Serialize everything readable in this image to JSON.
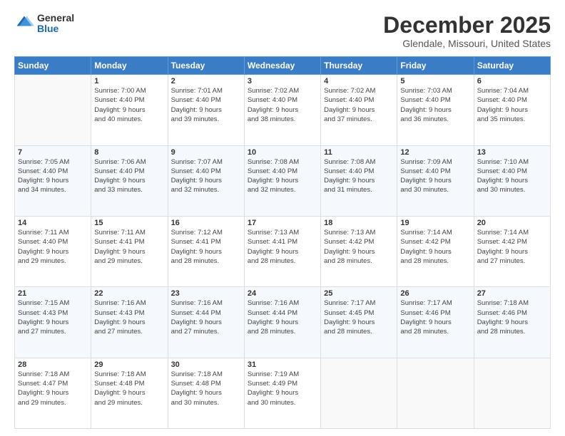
{
  "logo": {
    "general": "General",
    "blue": "Blue"
  },
  "title": "December 2025",
  "subtitle": "Glendale, Missouri, United States",
  "days_header": [
    "Sunday",
    "Monday",
    "Tuesday",
    "Wednesday",
    "Thursday",
    "Friday",
    "Saturday"
  ],
  "weeks": [
    [
      {
        "day": "",
        "info": ""
      },
      {
        "day": "1",
        "info": "Sunrise: 7:00 AM\nSunset: 4:40 PM\nDaylight: 9 hours\nand 40 minutes."
      },
      {
        "day": "2",
        "info": "Sunrise: 7:01 AM\nSunset: 4:40 PM\nDaylight: 9 hours\nand 39 minutes."
      },
      {
        "day": "3",
        "info": "Sunrise: 7:02 AM\nSunset: 4:40 PM\nDaylight: 9 hours\nand 38 minutes."
      },
      {
        "day": "4",
        "info": "Sunrise: 7:02 AM\nSunset: 4:40 PM\nDaylight: 9 hours\nand 37 minutes."
      },
      {
        "day": "5",
        "info": "Sunrise: 7:03 AM\nSunset: 4:40 PM\nDaylight: 9 hours\nand 36 minutes."
      },
      {
        "day": "6",
        "info": "Sunrise: 7:04 AM\nSunset: 4:40 PM\nDaylight: 9 hours\nand 35 minutes."
      }
    ],
    [
      {
        "day": "7",
        "info": "Sunrise: 7:05 AM\nSunset: 4:40 PM\nDaylight: 9 hours\nand 34 minutes."
      },
      {
        "day": "8",
        "info": "Sunrise: 7:06 AM\nSunset: 4:40 PM\nDaylight: 9 hours\nand 33 minutes."
      },
      {
        "day": "9",
        "info": "Sunrise: 7:07 AM\nSunset: 4:40 PM\nDaylight: 9 hours\nand 32 minutes."
      },
      {
        "day": "10",
        "info": "Sunrise: 7:08 AM\nSunset: 4:40 PM\nDaylight: 9 hours\nand 32 minutes."
      },
      {
        "day": "11",
        "info": "Sunrise: 7:08 AM\nSunset: 4:40 PM\nDaylight: 9 hours\nand 31 minutes."
      },
      {
        "day": "12",
        "info": "Sunrise: 7:09 AM\nSunset: 4:40 PM\nDaylight: 9 hours\nand 30 minutes."
      },
      {
        "day": "13",
        "info": "Sunrise: 7:10 AM\nSunset: 4:40 PM\nDaylight: 9 hours\nand 30 minutes."
      }
    ],
    [
      {
        "day": "14",
        "info": "Sunrise: 7:11 AM\nSunset: 4:40 PM\nDaylight: 9 hours\nand 29 minutes."
      },
      {
        "day": "15",
        "info": "Sunrise: 7:11 AM\nSunset: 4:41 PM\nDaylight: 9 hours\nand 29 minutes."
      },
      {
        "day": "16",
        "info": "Sunrise: 7:12 AM\nSunset: 4:41 PM\nDaylight: 9 hours\nand 28 minutes."
      },
      {
        "day": "17",
        "info": "Sunrise: 7:13 AM\nSunset: 4:41 PM\nDaylight: 9 hours\nand 28 minutes."
      },
      {
        "day": "18",
        "info": "Sunrise: 7:13 AM\nSunset: 4:42 PM\nDaylight: 9 hours\nand 28 minutes."
      },
      {
        "day": "19",
        "info": "Sunrise: 7:14 AM\nSunset: 4:42 PM\nDaylight: 9 hours\nand 28 minutes."
      },
      {
        "day": "20",
        "info": "Sunrise: 7:14 AM\nSunset: 4:42 PM\nDaylight: 9 hours\nand 27 minutes."
      }
    ],
    [
      {
        "day": "21",
        "info": "Sunrise: 7:15 AM\nSunset: 4:43 PM\nDaylight: 9 hours\nand 27 minutes."
      },
      {
        "day": "22",
        "info": "Sunrise: 7:16 AM\nSunset: 4:43 PM\nDaylight: 9 hours\nand 27 minutes."
      },
      {
        "day": "23",
        "info": "Sunrise: 7:16 AM\nSunset: 4:44 PM\nDaylight: 9 hours\nand 27 minutes."
      },
      {
        "day": "24",
        "info": "Sunrise: 7:16 AM\nSunset: 4:44 PM\nDaylight: 9 hours\nand 28 minutes."
      },
      {
        "day": "25",
        "info": "Sunrise: 7:17 AM\nSunset: 4:45 PM\nDaylight: 9 hours\nand 28 minutes."
      },
      {
        "day": "26",
        "info": "Sunrise: 7:17 AM\nSunset: 4:46 PM\nDaylight: 9 hours\nand 28 minutes."
      },
      {
        "day": "27",
        "info": "Sunrise: 7:18 AM\nSunset: 4:46 PM\nDaylight: 9 hours\nand 28 minutes."
      }
    ],
    [
      {
        "day": "28",
        "info": "Sunrise: 7:18 AM\nSunset: 4:47 PM\nDaylight: 9 hours\nand 29 minutes."
      },
      {
        "day": "29",
        "info": "Sunrise: 7:18 AM\nSunset: 4:48 PM\nDaylight: 9 hours\nand 29 minutes."
      },
      {
        "day": "30",
        "info": "Sunrise: 7:18 AM\nSunset: 4:48 PM\nDaylight: 9 hours\nand 30 minutes."
      },
      {
        "day": "31",
        "info": "Sunrise: 7:19 AM\nSunset: 4:49 PM\nDaylight: 9 hours\nand 30 minutes."
      },
      {
        "day": "",
        "info": ""
      },
      {
        "day": "",
        "info": ""
      },
      {
        "day": "",
        "info": ""
      }
    ]
  ]
}
